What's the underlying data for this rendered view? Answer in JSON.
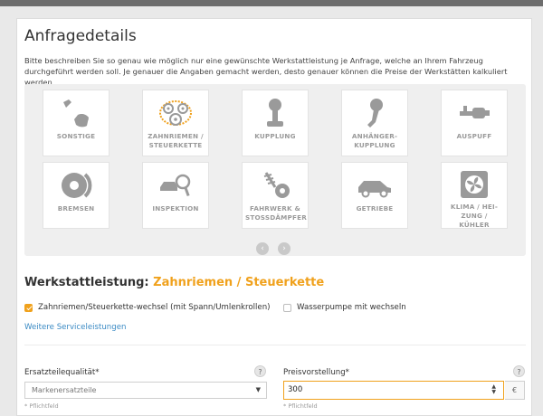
{
  "page": {
    "title": "Anfragedetails",
    "description": "Bitte beschreiben Sie so genau wie möglich nur eine gewünschte Werkstattleistung je Anfrage, welche an Ihrem Fahrzeug durchgeführt werden soll. Je genauer die Angaben gemacht werden, desto genauer können die Preise der Werkstätten kalkuliert werden."
  },
  "categories": [
    {
      "label": "SONSTIGE",
      "icon": "wrench-hand-icon"
    },
    {
      "label": "ZAHNRIEMEN / STEUERKETTE",
      "icon": "timing-belt-icon"
    },
    {
      "label": "KUPPLUNG",
      "icon": "clutch-pedal-icon"
    },
    {
      "label": "ANHÄNGER-KUPPLUNG",
      "icon": "tow-hitch-icon"
    },
    {
      "label": "AUSPUFF",
      "icon": "exhaust-pipe-icon"
    },
    {
      "label": "BREMSEN",
      "icon": "brake-disc-icon"
    },
    {
      "label": "INSPEKTION",
      "icon": "inspection-magnifier-icon"
    },
    {
      "label": "FAHRWERK & STOSSDÄMPFER",
      "icon": "shock-absorber-icon"
    },
    {
      "label": "GETRIEBE",
      "icon": "car-gearbox-icon"
    },
    {
      "label": "KLIMA / HEI-ZUNG / KÜHLER",
      "icon": "climate-fan-icon"
    }
  ],
  "pager": {
    "prev": "‹",
    "next": "›"
  },
  "service": {
    "heading_prefix": "Werkstattleistung:",
    "heading_value": "Zahnriemen / Steuerkette",
    "options": [
      {
        "label": "Zahnriemen/Steuerkette-wechsel (mit Spann/Umlenkrollen)",
        "checked": true
      },
      {
        "label": "Wasserpumpe mit wechseln",
        "checked": false
      }
    ],
    "more_link": "Weitere Serviceleistungen"
  },
  "form": {
    "quality_label": "Ersatzteilequalität*",
    "quality_value": "Markenersatzteile",
    "price_label": "Preisvorstellung*",
    "price_value": "300",
    "currency": "€",
    "help": "?",
    "required_note": "* Pflichtfeld"
  },
  "colors": {
    "accent": "#f0a11c",
    "link": "#3a8ac4",
    "icon_gray": "#9a9a9a"
  }
}
